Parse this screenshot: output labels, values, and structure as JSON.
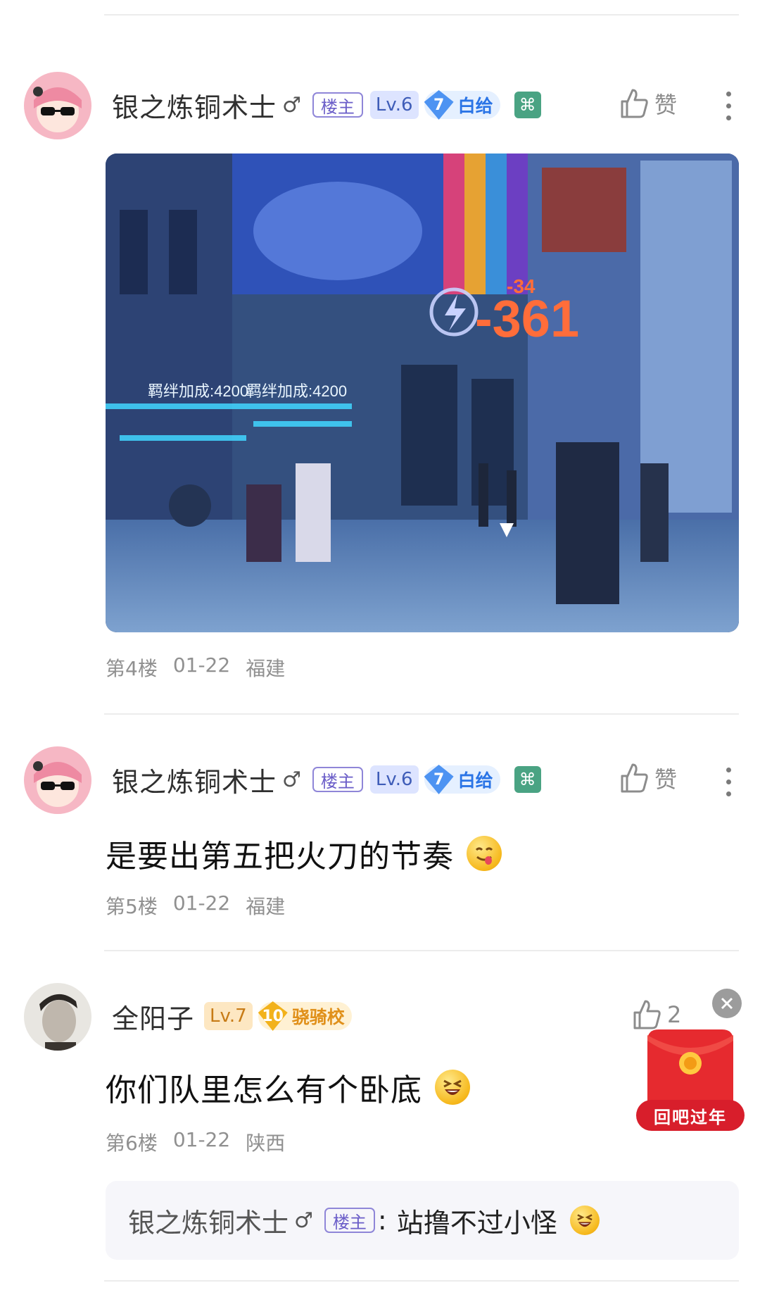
{
  "posts": [
    {
      "username": "银之炼铜术士",
      "gender": "♂",
      "owner_badge": "楼主",
      "level": "Lv.6",
      "title_level": "7",
      "title_name": "白给",
      "green_badge": "⌘",
      "like_label": "赞",
      "floor": "第4楼",
      "date": "01-22",
      "location": "福建"
    },
    {
      "username": "银之炼铜术士",
      "gender": "♂",
      "owner_badge": "楼主",
      "level": "Lv.6",
      "title_level": "7",
      "title_name": "白给",
      "green_badge": "⌘",
      "like_label": "赞",
      "content": "是要出第五把火刀的节奏",
      "floor": "第5楼",
      "date": "01-22",
      "location": "福建"
    },
    {
      "username": "全阳子",
      "level": "Lv.7",
      "title_level": "10",
      "title_name": "骁骑校",
      "like_count": "2",
      "content": "你们队里怎么有个卧底",
      "floor": "第6楼",
      "date": "01-22",
      "location": "陕西",
      "reply": {
        "username": "银之炼铜术士",
        "gender": "♂",
        "owner_badge": "楼主",
        "text": "站撸不过小怪"
      }
    }
  ],
  "game_screenshot": {
    "damage_main": "-361",
    "damage_small": "-34",
    "hud_left": "羁绊加成:4200",
    "hud_right": "羁绊加成:4200"
  },
  "red_packet": {
    "label": "回吧过年"
  },
  "icons": {
    "like": "thumbs-up-icon",
    "more": "more-vertical-icon",
    "close": "close-icon",
    "red_packet": "red-packet-icon"
  },
  "colors": {
    "divider": "#ececec",
    "owner_badge": "#6a5dc8",
    "level_badge_bg": "#dde4ff",
    "title_blue": "#2a74e6",
    "gold": "#e0901a",
    "meta_text": "#909090"
  }
}
